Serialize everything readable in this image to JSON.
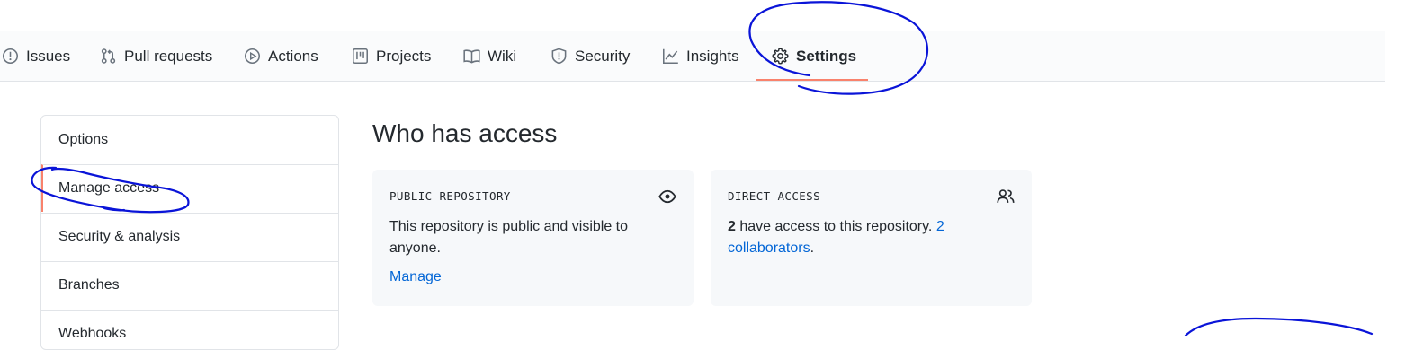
{
  "tabs": [
    {
      "label": "Issues",
      "icon": "issue-opened-icon"
    },
    {
      "label": "Pull requests",
      "icon": "git-pull-request-icon"
    },
    {
      "label": "Actions",
      "icon": "play-icon"
    },
    {
      "label": "Projects",
      "icon": "project-icon"
    },
    {
      "label": "Wiki",
      "icon": "book-icon"
    },
    {
      "label": "Security",
      "icon": "shield-icon"
    },
    {
      "label": "Insights",
      "icon": "graph-icon"
    },
    {
      "label": "Settings",
      "icon": "gear-icon",
      "selected": true
    }
  ],
  "sidebar": {
    "items": [
      {
        "label": "Options"
      },
      {
        "label": "Manage access",
        "active": true
      },
      {
        "label": "Security & analysis"
      },
      {
        "label": "Branches"
      },
      {
        "label": "Webhooks"
      }
    ]
  },
  "main": {
    "title": "Who has access",
    "public_card": {
      "title": "PUBLIC REPOSITORY",
      "icon": "eye-icon",
      "text": "This repository is public and visible to anyone.",
      "link": "Manage"
    },
    "direct_card": {
      "title": "DIRECT ACCESS",
      "icon": "people-icon",
      "count": "2",
      "text": " have access to this repository. ",
      "link": "2 collaborators",
      "period": "."
    }
  },
  "colors": {
    "accent": "#f9826c",
    "link": "#0366d6",
    "annotation": "#0a14d8"
  }
}
